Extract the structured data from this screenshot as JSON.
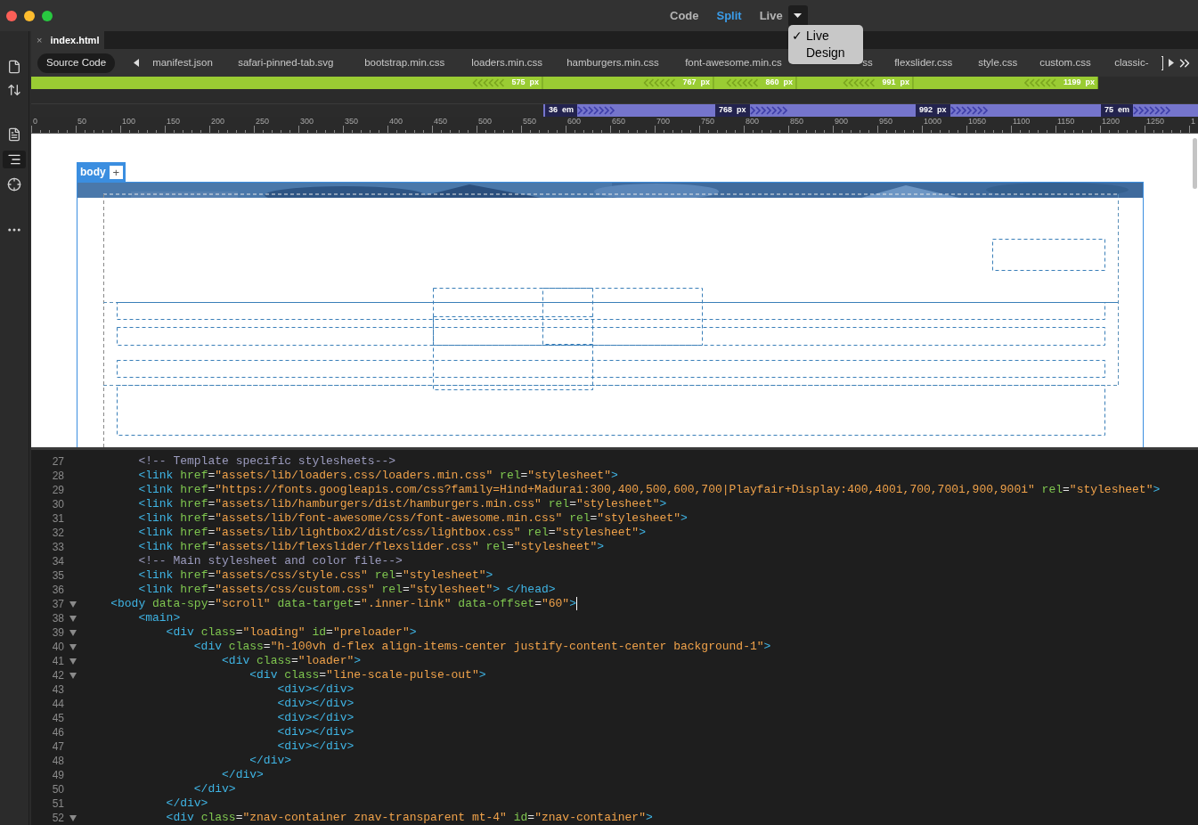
{
  "view_modes": [
    {
      "label": "Code",
      "selected": false
    },
    {
      "label": "Split",
      "selected": true
    },
    {
      "label": "Live",
      "selected": false
    }
  ],
  "view_menu": {
    "items": [
      {
        "label": "Live",
        "checked": true,
        "mark": "✓"
      },
      {
        "label": "Design",
        "checked": false
      }
    ]
  },
  "document_tab": {
    "label": "index.html",
    "close": "×"
  },
  "related_files": [
    {
      "label": "Source Code",
      "selected": true
    },
    {
      "label": "manifest.json",
      "selected": false
    },
    {
      "label": "safari-pinned-tab.svg",
      "selected": false
    },
    {
      "label": "bootstrap.min.css",
      "selected": false
    },
    {
      "label": "loaders.min.css",
      "selected": false
    },
    {
      "label": "hamburgers.min.css",
      "selected": false
    },
    {
      "label": "font-awesome.min.cs",
      "selected": false
    },
    {
      "label": "ss",
      "selected": false
    },
    {
      "label": "flexslider.css",
      "selected": false
    },
    {
      "label": "style.css",
      "selected": false
    },
    {
      "label": "custom.css",
      "selected": false
    },
    {
      "label": "classic-",
      "selected": false
    }
  ],
  "max_width_queries": [
    {
      "value": "575",
      "unit": "px"
    },
    {
      "value": "767",
      "unit": "px"
    },
    {
      "value": "860",
      "unit": "px"
    },
    {
      "value": "991",
      "unit": "px"
    },
    {
      "value": "1199",
      "unit": "px"
    }
  ],
  "min_width_queries": [
    {
      "value": "36",
      "unit": "em"
    },
    {
      "value": "768",
      "unit": "px"
    },
    {
      "value": "992",
      "unit": "px"
    },
    {
      "value": "75",
      "unit": "em"
    }
  ],
  "ruler": {
    "labels": [
      "0",
      "50",
      "100",
      "150",
      "200",
      "250",
      "300",
      "350",
      "400",
      "450",
      "500",
      "550",
      "600",
      "650",
      "700",
      "750",
      "800",
      "850",
      "900",
      "950",
      "1000",
      "1050",
      "1100",
      "1150",
      "1200",
      "1250",
      "1"
    ]
  },
  "design_view": {
    "element_tag": "body",
    "add_button": "+"
  },
  "code_lines": [
    {
      "number": "27",
      "fold": false,
      "cursor": false,
      "tokens": [
        {
          "kind": "comment",
          "text": "        <!-- Template specific stylesheets-->"
        }
      ]
    },
    {
      "number": "28",
      "fold": false,
      "cursor": false,
      "tokens": [
        {
          "kind": "tag",
          "text": "        <link"
        },
        {
          "kind": "attr",
          "text": " href"
        },
        {
          "kind": "punct",
          "text": "="
        },
        {
          "kind": "str",
          "text": "\"assets/lib/loaders.css/loaders.min.css\""
        },
        {
          "kind": "attr",
          "text": " rel"
        },
        {
          "kind": "punct",
          "text": "="
        },
        {
          "kind": "str",
          "text": "\"stylesheet\""
        },
        {
          "kind": "tag",
          "text": ">"
        }
      ]
    },
    {
      "number": "29",
      "fold": false,
      "cursor": false,
      "tokens": [
        {
          "kind": "tag",
          "text": "        <link"
        },
        {
          "kind": "attr",
          "text": " href"
        },
        {
          "kind": "punct",
          "text": "="
        },
        {
          "kind": "str",
          "text": "\"https://fonts.googleapis.com/css?family=Hind+Madurai:300,400,500,600,700|Playfair+Display:400,400i,700,700i,900,900i\""
        },
        {
          "kind": "attr",
          "text": " rel"
        },
        {
          "kind": "punct",
          "text": "="
        },
        {
          "kind": "str",
          "text": "\"stylesheet\""
        },
        {
          "kind": "tag",
          "text": ">"
        }
      ]
    },
    {
      "number": "30",
      "fold": false,
      "cursor": false,
      "tokens": [
        {
          "kind": "tag",
          "text": "        <link"
        },
        {
          "kind": "attr",
          "text": " href"
        },
        {
          "kind": "punct",
          "text": "="
        },
        {
          "kind": "str",
          "text": "\"assets/lib/hamburgers/dist/hamburgers.min.css\""
        },
        {
          "kind": "attr",
          "text": " rel"
        },
        {
          "kind": "punct",
          "text": "="
        },
        {
          "kind": "str",
          "text": "\"stylesheet\""
        },
        {
          "kind": "tag",
          "text": ">"
        }
      ]
    },
    {
      "number": "31",
      "fold": false,
      "cursor": false,
      "tokens": [
        {
          "kind": "tag",
          "text": "        <link"
        },
        {
          "kind": "attr",
          "text": " href"
        },
        {
          "kind": "punct",
          "text": "="
        },
        {
          "kind": "str",
          "text": "\"assets/lib/font-awesome/css/font-awesome.min.css\""
        },
        {
          "kind": "attr",
          "text": " rel"
        },
        {
          "kind": "punct",
          "text": "="
        },
        {
          "kind": "str",
          "text": "\"stylesheet\""
        },
        {
          "kind": "tag",
          "text": ">"
        }
      ]
    },
    {
      "number": "32",
      "fold": false,
      "cursor": false,
      "tokens": [
        {
          "kind": "tag",
          "text": "        <link"
        },
        {
          "kind": "attr",
          "text": " href"
        },
        {
          "kind": "punct",
          "text": "="
        },
        {
          "kind": "str",
          "text": "\"assets/lib/lightbox2/dist/css/lightbox.css\""
        },
        {
          "kind": "attr",
          "text": " rel"
        },
        {
          "kind": "punct",
          "text": "="
        },
        {
          "kind": "str",
          "text": "\"stylesheet\""
        },
        {
          "kind": "tag",
          "text": ">"
        }
      ]
    },
    {
      "number": "33",
      "fold": false,
      "cursor": false,
      "tokens": [
        {
          "kind": "tag",
          "text": "        <link"
        },
        {
          "kind": "attr",
          "text": " href"
        },
        {
          "kind": "punct",
          "text": "="
        },
        {
          "kind": "str",
          "text": "\"assets/lib/flexslider/flexslider.css\""
        },
        {
          "kind": "attr",
          "text": " rel"
        },
        {
          "kind": "punct",
          "text": "="
        },
        {
          "kind": "str",
          "text": "\"stylesheet\""
        },
        {
          "kind": "tag",
          "text": ">"
        }
      ]
    },
    {
      "number": "34",
      "fold": false,
      "cursor": false,
      "tokens": [
        {
          "kind": "comment",
          "text": "        <!-- Main stylesheet and color file-->"
        }
      ]
    },
    {
      "number": "35",
      "fold": false,
      "cursor": false,
      "tokens": [
        {
          "kind": "tag",
          "text": "        <link"
        },
        {
          "kind": "attr",
          "text": " href"
        },
        {
          "kind": "punct",
          "text": "="
        },
        {
          "kind": "str",
          "text": "\"assets/css/style.css\""
        },
        {
          "kind": "attr",
          "text": " rel"
        },
        {
          "kind": "punct",
          "text": "="
        },
        {
          "kind": "str",
          "text": "\"stylesheet\""
        },
        {
          "kind": "tag",
          "text": ">"
        }
      ]
    },
    {
      "number": "36",
      "fold": false,
      "cursor": false,
      "tokens": [
        {
          "kind": "tag",
          "text": "        <link"
        },
        {
          "kind": "attr",
          "text": " href"
        },
        {
          "kind": "punct",
          "text": "="
        },
        {
          "kind": "str",
          "text": "\"assets/css/custom.css\""
        },
        {
          "kind": "attr",
          "text": " rel"
        },
        {
          "kind": "punct",
          "text": "="
        },
        {
          "kind": "str",
          "text": "\"stylesheet\""
        },
        {
          "kind": "tag",
          "text": "> </head>"
        }
      ]
    },
    {
      "number": "37",
      "fold": true,
      "cursor": true,
      "tokens": [
        {
          "kind": "tag",
          "text": "    <body"
        },
        {
          "kind": "attr",
          "text": " data-spy"
        },
        {
          "kind": "punct",
          "text": "="
        },
        {
          "kind": "str",
          "text": "\"scroll\""
        },
        {
          "kind": "attr",
          "text": " data-target"
        },
        {
          "kind": "punct",
          "text": "="
        },
        {
          "kind": "str",
          "text": "\".inner-link\""
        },
        {
          "kind": "attr",
          "text": " data-offset"
        },
        {
          "kind": "punct",
          "text": "="
        },
        {
          "kind": "str",
          "text": "\"60\""
        },
        {
          "kind": "tag",
          "text": ">"
        }
      ]
    },
    {
      "number": "38",
      "fold": true,
      "cursor": false,
      "tokens": [
        {
          "kind": "tag",
          "text": "        <main>"
        }
      ]
    },
    {
      "number": "39",
      "fold": true,
      "cursor": false,
      "tokens": [
        {
          "kind": "tag",
          "text": "            <div"
        },
        {
          "kind": "attr",
          "text": " class"
        },
        {
          "kind": "punct",
          "text": "="
        },
        {
          "kind": "str",
          "text": "\"loading\""
        },
        {
          "kind": "attr",
          "text": " id"
        },
        {
          "kind": "punct",
          "text": "="
        },
        {
          "kind": "str",
          "text": "\"preloader\""
        },
        {
          "kind": "tag",
          "text": ">"
        }
      ]
    },
    {
      "number": "40",
      "fold": true,
      "cursor": false,
      "tokens": [
        {
          "kind": "tag",
          "text": "                <div"
        },
        {
          "kind": "attr",
          "text": " class"
        },
        {
          "kind": "punct",
          "text": "="
        },
        {
          "kind": "str",
          "text": "\"h-100vh d-flex align-items-center justify-content-center background-1\""
        },
        {
          "kind": "tag",
          "text": ">"
        }
      ]
    },
    {
      "number": "41",
      "fold": true,
      "cursor": false,
      "tokens": [
        {
          "kind": "tag",
          "text": "                    <div"
        },
        {
          "kind": "attr",
          "text": " class"
        },
        {
          "kind": "punct",
          "text": "="
        },
        {
          "kind": "str",
          "text": "\"loader\""
        },
        {
          "kind": "tag",
          "text": ">"
        }
      ]
    },
    {
      "number": "42",
      "fold": true,
      "cursor": false,
      "tokens": [
        {
          "kind": "tag",
          "text": "                        <div"
        },
        {
          "kind": "attr",
          "text": " class"
        },
        {
          "kind": "punct",
          "text": "="
        },
        {
          "kind": "str",
          "text": "\"line-scale-pulse-out\""
        },
        {
          "kind": "tag",
          "text": ">"
        }
      ]
    },
    {
      "number": "43",
      "fold": false,
      "cursor": false,
      "tokens": [
        {
          "kind": "tag",
          "text": "                            <div></div>"
        }
      ]
    },
    {
      "number": "44",
      "fold": false,
      "cursor": false,
      "tokens": [
        {
          "kind": "tag",
          "text": "                            <div></div>"
        }
      ]
    },
    {
      "number": "45",
      "fold": false,
      "cursor": false,
      "tokens": [
        {
          "kind": "tag",
          "text": "                            <div></div>"
        }
      ]
    },
    {
      "number": "46",
      "fold": false,
      "cursor": false,
      "tokens": [
        {
          "kind": "tag",
          "text": "                            <div></div>"
        }
      ]
    },
    {
      "number": "47",
      "fold": false,
      "cursor": false,
      "tokens": [
        {
          "kind": "tag",
          "text": "                            <div></div>"
        }
      ]
    },
    {
      "number": "48",
      "fold": false,
      "cursor": false,
      "tokens": [
        {
          "kind": "tag",
          "text": "                        </div>"
        }
      ]
    },
    {
      "number": "49",
      "fold": false,
      "cursor": false,
      "tokens": [
        {
          "kind": "tag",
          "text": "                    </div>"
        }
      ]
    },
    {
      "number": "50",
      "fold": false,
      "cursor": false,
      "tokens": [
        {
          "kind": "tag",
          "text": "                </div>"
        }
      ]
    },
    {
      "number": "51",
      "fold": false,
      "cursor": false,
      "tokens": [
        {
          "kind": "tag",
          "text": "            </div>"
        }
      ]
    },
    {
      "number": "52",
      "fold": true,
      "cursor": false,
      "tokens": [
        {
          "kind": "tag",
          "text": "            <div"
        },
        {
          "kind": "attr",
          "text": " class"
        },
        {
          "kind": "punct",
          "text": "="
        },
        {
          "kind": "str",
          "text": "\"znav-container znav-transparent mt-4\""
        },
        {
          "kind": "attr",
          "text": " id"
        },
        {
          "kind": "punct",
          "text": "="
        },
        {
          "kind": "str",
          "text": "\"znav-container\""
        },
        {
          "kind": "tag",
          "text": ">"
        }
      ]
    }
  ]
}
